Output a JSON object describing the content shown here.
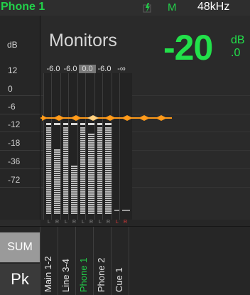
{
  "header": {
    "title": "Phone 1",
    "power_icon": "power-charge-icon",
    "mode": "M",
    "sample_rate": "48kHz"
  },
  "scale": {
    "unit": "dB",
    "ticks": [
      "12",
      "0",
      "-6",
      "-12",
      "-18",
      "-36",
      "-72"
    ]
  },
  "monitors": {
    "title": "Monitors",
    "level": "-20",
    "level_unit": "dB",
    "level_decimal": ".0"
  },
  "channel_gains": [
    "-6.0",
    "-6.0",
    "0.0",
    "-6.0",
    "-∞"
  ],
  "lr_labels": [
    "L",
    "R",
    "L",
    "R",
    "L",
    "R",
    "L",
    "R",
    "L",
    "R"
  ],
  "side": {
    "sum_label": "SUM",
    "pk_label": "Pk"
  },
  "channels": [
    "Main 1-2",
    "Line 3-4",
    "Phone 1",
    "Phone 2",
    "Cue 1"
  ],
  "colors": {
    "accent_green": "#22d14a",
    "fader_orange": "#ff9a1a",
    "cue_red": "#e23a3a"
  }
}
